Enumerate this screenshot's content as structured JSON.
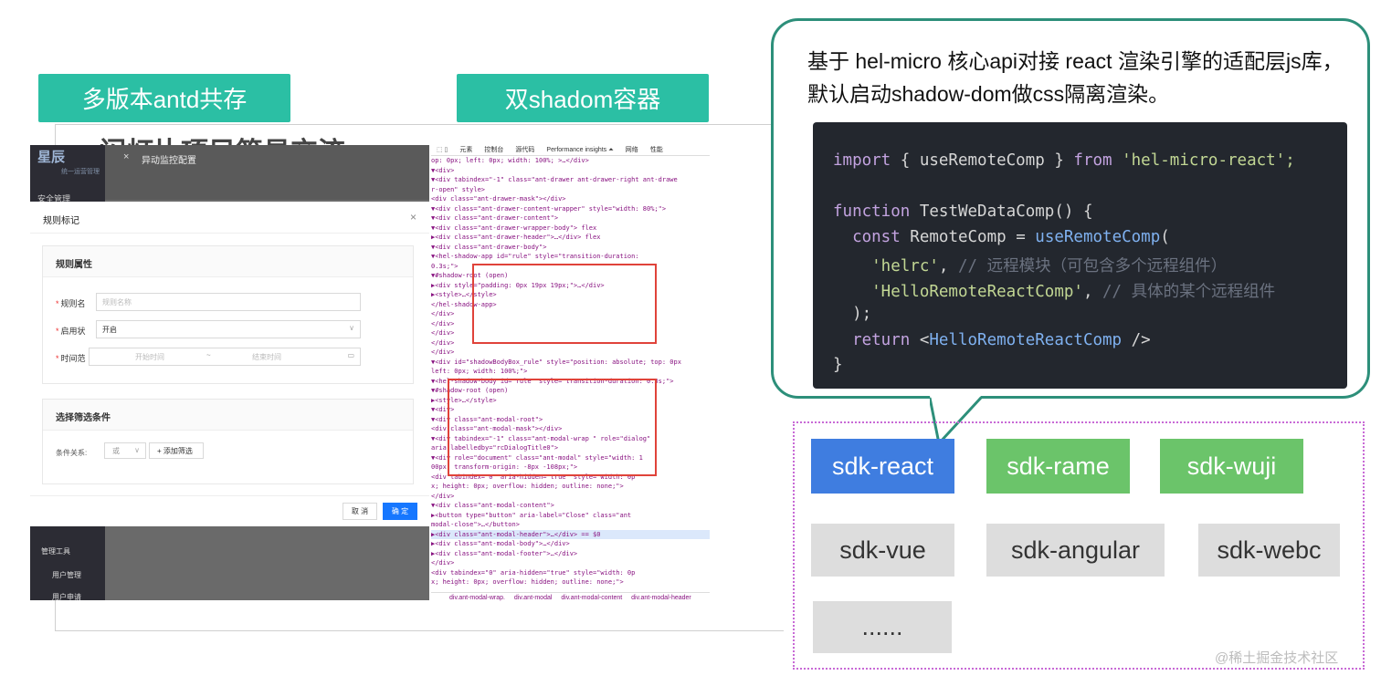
{
  "tags": [
    "多版本antd共存",
    "双shadom容器"
  ],
  "slide_title": "闪灯片项目简易交流",
  "left_screenshot": {
    "logo": "星辰",
    "logo_sub": "统一运营管理",
    "sidebar_items": [
      "安全管理",
      "管理工具",
      "用户管理",
      "用户申请"
    ],
    "drawer_close": "×",
    "drawer_title": "异动监控配置",
    "modal_title": "规则标记",
    "modal_close": "×",
    "card1_title": "规则属性",
    "fields": [
      {
        "label": "规则名",
        "placeholder": "规则名称"
      },
      {
        "label": "启用状",
        "value": "开启"
      },
      {
        "label": "时间范",
        "start": "开始时间",
        "sep": "~",
        "end": "结束时间"
      }
    ],
    "card2_title": "选择筛选条件",
    "cond_label": "条件关系:",
    "cond_value": "或",
    "add_filter": "+ 添加筛选",
    "cancel": "取 消",
    "ok": "确 定"
  },
  "devtools": {
    "tabs": [
      "元素",
      "控制台",
      "源代码",
      "Performance insights ⏶",
      "网络",
      "性能"
    ],
    "lines": [
      "op: 0px; left: 0px; width: 100%; >…</div>",
      "  ▼<div>",
      "    ▼<div tabindex=\"-1\" class=\"ant-drawer ant-drawer-right ant-drawe",
      "      r-open\" style>",
      "        <div class=\"ant-drawer-mask\"></div>",
      "      ▼<div class=\"ant-drawer-content-wrapper\" style=\"width: 80%;\">",
      "        ▼<div class=\"ant-drawer-content\">",
      "          ▼<div class=\"ant-drawer-wrapper-body\"> flex",
      "            ▶<div class=\"ant-drawer-header\">…</div> flex",
      "            ▼<div class=\"ant-drawer-body\">",
      "              ▼<hel-shadow-app id=\"rule\" style=\"transition-duration:",
      "                0.3s;\">",
      "                ▼#shadow-root (open)",
      "                  ▶<div style=\"padding: 0px 19px 19px;\">…</div>",
      "                  ▶<style>…</style>",
      "                </hel-shadow-app>",
      "              </div>",
      "            </div>",
      "          </div>",
      "        </div>",
      "      </div>",
      "    ▼<div id=\"shadowBodyBox_rule\" style=\"position: absolute; top: 0px",
      "      left: 0px; width: 100%;\">",
      "      ▼<hel-shadow-body id=\"rule\" style=\"transition-duration: 0.3s;\">",
      "        ▼#shadow-root (open)",
      "          ▶<style>…</style>",
      "          ▼<div>",
      "            ▼<div class=\"ant-modal-root\">",
      "                <div class=\"ant-modal-mask\"></div>",
      "              ▼<div tabindex=\"-1\" class=\"ant-modal-wrap \" role=\"dialog\"",
      "                aria-labelledby=\"rcDialogTitle0\">",
      "                ▼<div role=\"document\" class=\"ant-modal\" style=\"width: 1",
      "                  00px; transform-origin: -8px -108px;\">",
      "                    <div tabindex=\"0\" aria-hidden=\"true\" style=\"width: 0p",
      "                    x; height: 0px; overflow: hidden; outline: none;\">",
      "                    </div>",
      "                  ▼<div class=\"ant-modal-content\">",
      "                    ▶<button type=\"button\" aria-label=\"Close\" class=\"ant",
      "                      modal-close\">…</button>",
      "                    ▶<div class=\"ant-modal-header\">…</div> == $0",
      "                    ▶<div class=\"ant-modal-body\">…</div>",
      "                    ▶<div class=\"ant-modal-footer\">…</div>",
      "                  </div>",
      "                  <div tabindex=\"0\" aria-hidden=\"true\" style=\"width: 0p",
      "                  x; height: 0px; overflow: hidden; outline: none;\">"
    ],
    "breadcrumbs": [
      "div.ant-modal-wrap.",
      "div.ant-modal",
      "div.ant-modal-content",
      "div.ant-modal-header"
    ]
  },
  "callout": {
    "text": "基于 hel-micro 核心api对接 react 渲染引擎的适配层js库，默认启动shadow-dom做css隔离渲染。",
    "code": {
      "l1_kw": "import",
      "l1_a": " { useRemoteComp } ",
      "l1_kw2": "from",
      "l1_str": " 'hel-micro-react';",
      "l2_kw": "function",
      "l2_a": " TestWeDataComp() {",
      "l3_kw": "  const",
      "l3_a": " RemoteComp = ",
      "l3_fn": "useRemoteComp",
      "l3_b": "(",
      "l4_str": "    'helrc'",
      "l4_a": ", ",
      "l4_cmt": "// 远程模块（可包含多个远程组件）",
      "l5_str": "    'HelloRemoteReactComp'",
      "l5_a": ", ",
      "l5_cmt": "// 具体的某个远程组件",
      "l6": "  );",
      "l7_kw": "  return",
      "l7_a": " <",
      "l7_fn": "HelloRemoteReactComp",
      "l7_b": " />",
      "l8": "}"
    }
  },
  "sdks": [
    "sdk-react",
    "sdk-rame",
    "sdk-wuji",
    "sdk-vue",
    "sdk-angular",
    "sdk-webc",
    "......"
  ],
  "colors": {
    "teal": "#2bbfa4",
    "sdk_blue": "#3f7de0",
    "sdk_green": "#6bc46a",
    "sdk_gray": "#dddddd"
  },
  "watermark": "@稀土掘金技术社区"
}
